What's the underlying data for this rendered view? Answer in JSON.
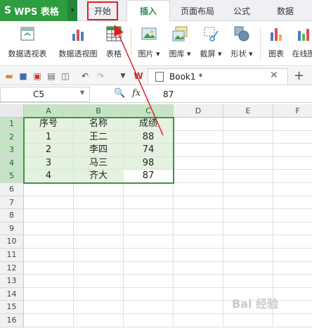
{
  "app": {
    "logo": "S",
    "title": "WPS 表格",
    "caret": "▾"
  },
  "tabs": {
    "start": "开始",
    "insert": "插入",
    "layout": "页面布局",
    "formula": "公式",
    "data": "数据"
  },
  "ribbon": {
    "pivot_table": "数据透视表",
    "pivot_chart": "数据透视图",
    "table": "表格",
    "picture": "图片",
    "gallery": "图库",
    "screenshot": "截屏",
    "shape": "形状",
    "chart": "图表",
    "online_chart": "在线图"
  },
  "document": {
    "name": "Book1 *",
    "close": "✕",
    "add": "+"
  },
  "formula_bar": {
    "cell_ref": "C5",
    "fx": "fx",
    "value": "87"
  },
  "columns": [
    "A",
    "B",
    "C",
    "D",
    "E",
    "F"
  ],
  "rows": [
    "1",
    "2",
    "3",
    "4",
    "5",
    "6",
    "7",
    "8",
    "9",
    "10",
    "11",
    "12",
    "13",
    "14",
    "15",
    "16"
  ],
  "table": {
    "headers": [
      "序号",
      "名称",
      "成绩"
    ],
    "rows": [
      [
        "1",
        "王二",
        "88"
      ],
      [
        "2",
        "李四",
        "74"
      ],
      [
        "3",
        "马三",
        "98"
      ],
      [
        "4",
        "齐大",
        "87"
      ]
    ]
  },
  "watermark": "Bai 经验",
  "colors": {
    "accent": "#2e9d3f",
    "highlight_border": "#e02020",
    "selection": "#3d9441",
    "fill": "#e4f2e0"
  }
}
